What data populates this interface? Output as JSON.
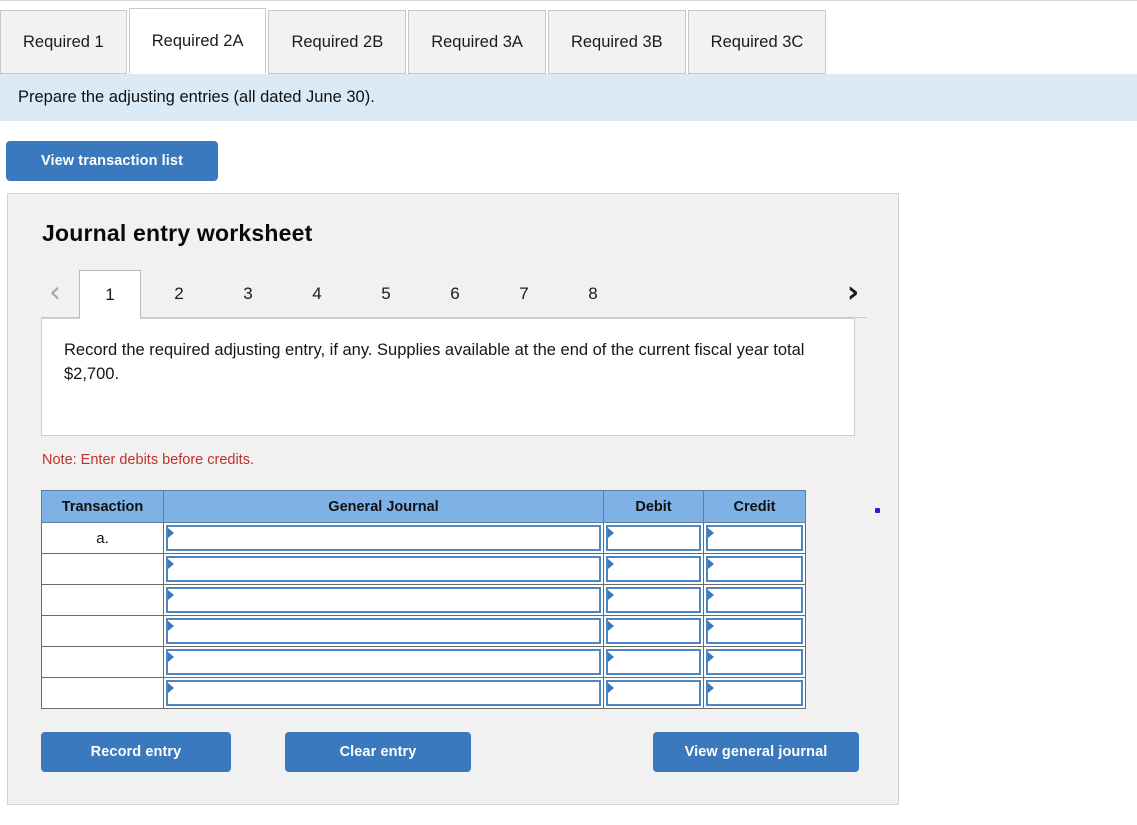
{
  "tabs": [
    {
      "label": "Required 1",
      "active": false
    },
    {
      "label": "Required 2A",
      "active": true
    },
    {
      "label": "Required 2B",
      "active": false
    },
    {
      "label": "Required 3A",
      "active": false
    },
    {
      "label": "Required 3B",
      "active": false
    },
    {
      "label": "Required 3C",
      "active": false
    }
  ],
  "instruction_bar": {
    "text": "Prepare the adjusting entries (all dated June 30)."
  },
  "toolbar": {
    "view_transaction_list_label": "View transaction list"
  },
  "worksheet": {
    "title": "Journal entry worksheet",
    "pager": {
      "prev_icon": "‹",
      "next_icon": "›",
      "pages": [
        "1",
        "2",
        "3",
        "4",
        "5",
        "6",
        "7",
        "8"
      ],
      "active_page": "1"
    },
    "prompt": "Record the required adjusting entry, if any. Supplies available at the end of the current fiscal year total $2,700.",
    "note": "Note: Enter debits before credits.",
    "table": {
      "columns": [
        "Transaction",
        "General Journal",
        "Debit",
        "Credit"
      ],
      "rows": [
        {
          "transaction": "a.",
          "general_journal": "",
          "debit": "",
          "credit": ""
        },
        {
          "transaction": "",
          "general_journal": "",
          "debit": "",
          "credit": ""
        },
        {
          "transaction": "",
          "general_journal": "",
          "debit": "",
          "credit": ""
        },
        {
          "transaction": "",
          "general_journal": "",
          "debit": "",
          "credit": ""
        },
        {
          "transaction": "",
          "general_journal": "",
          "debit": "",
          "credit": ""
        },
        {
          "transaction": "",
          "general_journal": "",
          "debit": "",
          "credit": ""
        }
      ]
    },
    "actions": {
      "record_entry_label": "Record entry",
      "clear_entry_label": "Clear entry",
      "view_general_journal_label": "View general journal"
    }
  },
  "colors": {
    "button_blue": "#3a79bd",
    "table_header_blue": "#7eb1e4",
    "instruction_bar_blue": "#daeaf7",
    "note_red": "#c0312c",
    "panel_gray": "#f1f1f1",
    "input_border_blue": "#4e87c0"
  }
}
